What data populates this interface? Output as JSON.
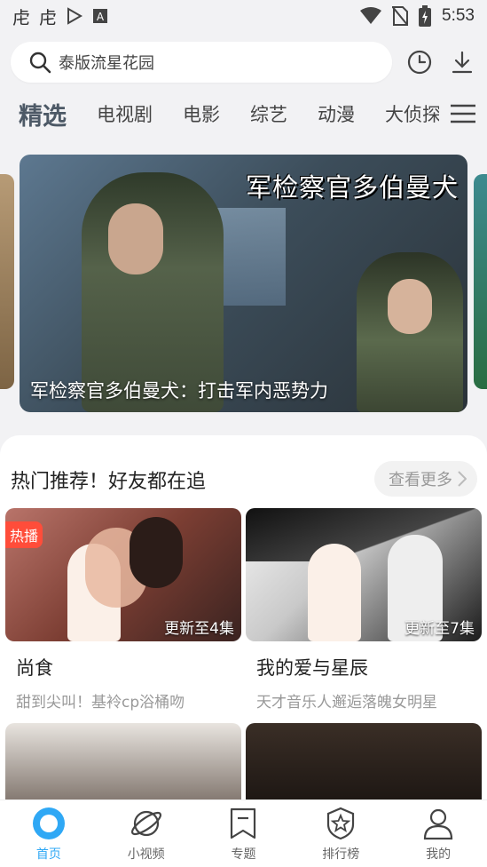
{
  "status_bar": {
    "time": "5:53",
    "left_icons": [
      "app-notification-icon",
      "app-notification-icon",
      "play-store-icon",
      "a-badge-icon"
    ],
    "right_icons": [
      "wifi-icon",
      "no-sim-icon",
      "battery-icon"
    ]
  },
  "search": {
    "placeholder": "泰版流星花园"
  },
  "top_actions": [
    "history-icon",
    "download-icon"
  ],
  "tabs": {
    "items": [
      "精选",
      "电视剧",
      "电影",
      "综艺",
      "动漫",
      "大侦探"
    ],
    "active": "精选"
  },
  "banner": {
    "title_art": "军检察官多伯曼犬",
    "caption": "军检察官多伯曼犬：打击军内恶势力"
  },
  "section": {
    "title": "热门推荐！好友都在追",
    "more_label": "查看更多"
  },
  "cards": [
    {
      "badge": "热播",
      "episode": "更新至4集",
      "title": "尚食",
      "subtitle": "甜到尖叫！基袊cp浴桶吻"
    },
    {
      "badge": "",
      "episode": "更新至7集",
      "title": "我的爱与星辰",
      "subtitle": "天才音乐人邂逅落魄女明星"
    }
  ],
  "bottom_nav": {
    "items": [
      {
        "label": "首页",
        "icon": "home-icon",
        "active": true
      },
      {
        "label": "小视频",
        "icon": "planet-icon",
        "active": false
      },
      {
        "label": "专题",
        "icon": "bookmark-icon",
        "active": false
      },
      {
        "label": "排行榜",
        "icon": "star-shield-icon",
        "active": false
      },
      {
        "label": "我的",
        "icon": "profile-icon",
        "active": false
      }
    ]
  },
  "colors": {
    "accent": "#2fa8f5",
    "hot_badge": "#ff4d3a",
    "active_tab": "#4d5966"
  }
}
